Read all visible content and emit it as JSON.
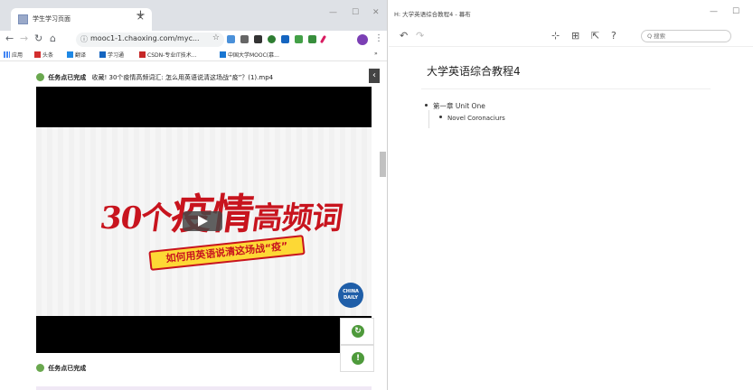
{
  "browser": {
    "tab_title": "学生学习页面",
    "tab_close": "×",
    "new_tab": "+",
    "win_min": "—",
    "win_max": "☐",
    "win_close": "✕",
    "url": "mooc1-1.chaoxing.com/myc...",
    "bookmarks": [
      "应用",
      "头条",
      "翻译",
      "学习通",
      "CSDN-专业IT技术...",
      "中国大学MOOC(慕..."
    ],
    "bookmarks_more": "»"
  },
  "page": {
    "task1_status": "任务点已完成",
    "task1_title": "收藏! 30个疫情高频词汇: 怎么用英语说清这场战“疫”？(1).mp4",
    "poster_num": "30个",
    "poster_main": "疫情",
    "poster_tail": "高频词",
    "poster_sub": "如何用英语说清这场战“疫”",
    "china_daily": "CHINA DAILY",
    "task2_status": "任务点已完成"
  },
  "app": {
    "window_title": "H: 大学英语综合教程4 - 幕布",
    "search_placeholder": "Q 搜索",
    "doc_title": "大学英语综合教程4",
    "node1": "第一章 Unit One",
    "node2": "Novel Coronaciurs"
  },
  "colors": {
    "accent_red": "#c8141e",
    "task_green": "#6aa84f"
  }
}
